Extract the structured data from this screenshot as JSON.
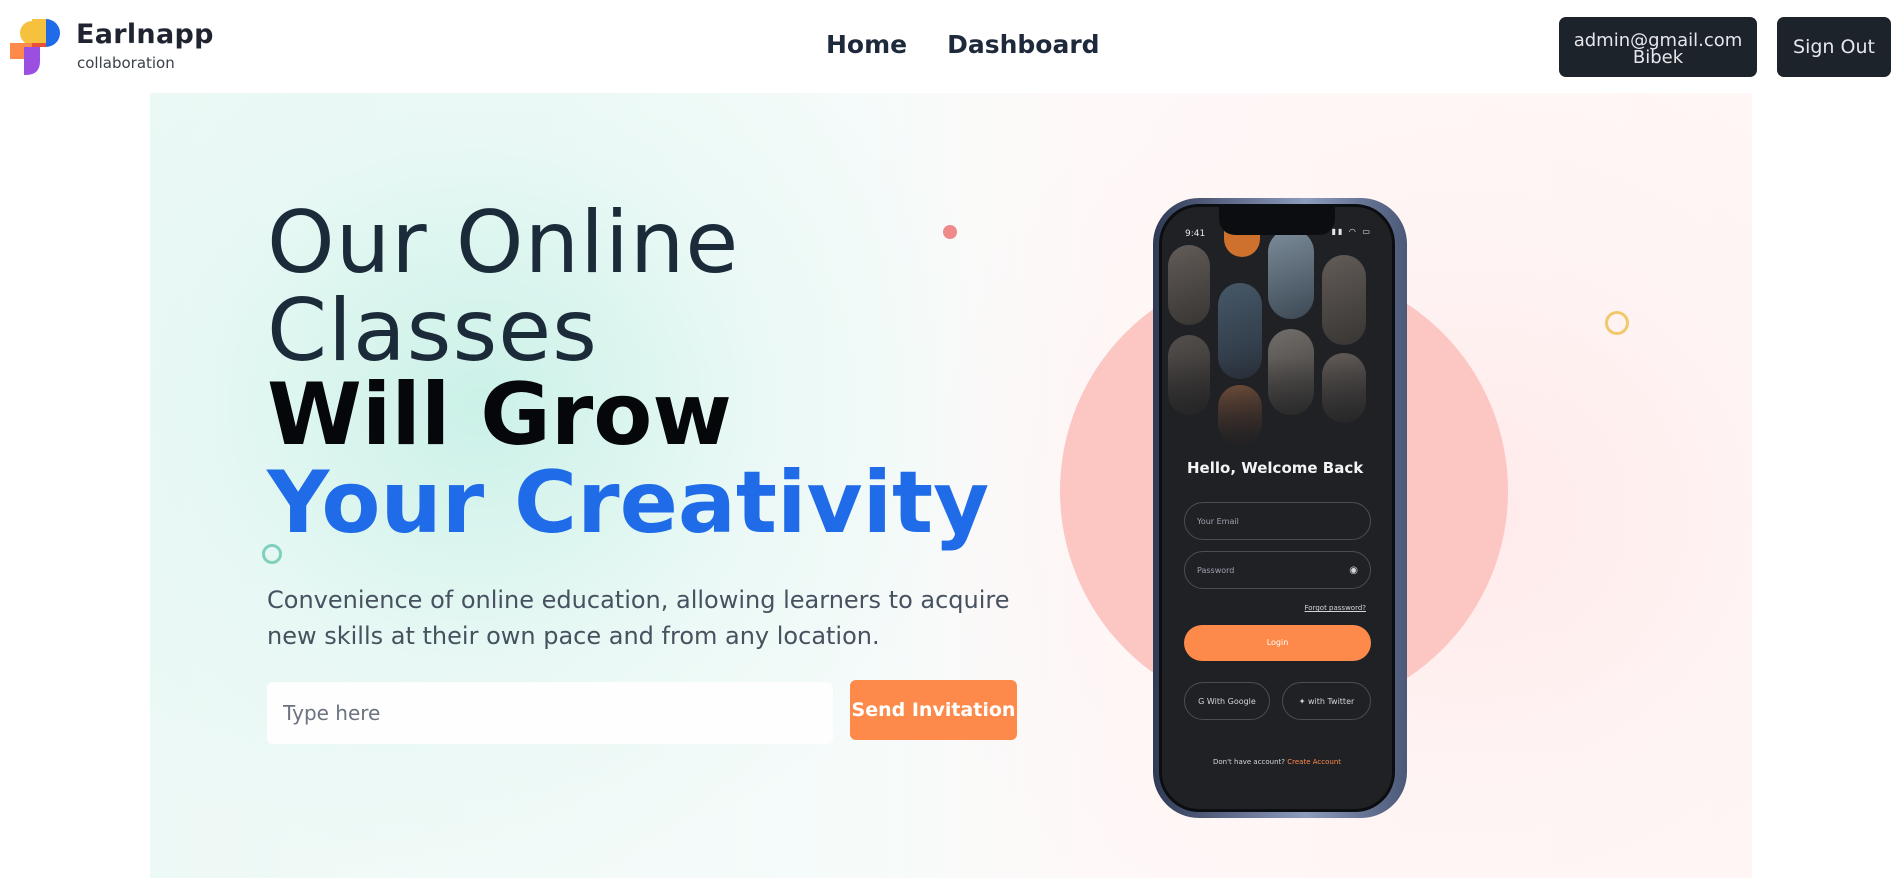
{
  "header": {
    "logo_name": "Earlnapp",
    "logo_sub": "collaboration",
    "nav": [
      {
        "label": "Home"
      },
      {
        "label": "Dashboard"
      }
    ],
    "user_email": "admin@gmail.com",
    "user_name": "Bibek",
    "signout_label": "Sign Out"
  },
  "hero": {
    "line1": "Our Online",
    "line2": "Classes",
    "line3": "Will Grow",
    "line4": "Your Creativity",
    "description": "Convenience of online education, allowing learners to acquire new skills at their own pace and from any location.",
    "input_placeholder": "Type here",
    "send_label": "Send Invitation"
  },
  "phone": {
    "time": "9:41",
    "welcome": "Hello, Welcome Back",
    "email_placeholder": "Your Email",
    "password_placeholder": "Password",
    "forgot": "Forgot password?",
    "login": "Login",
    "google": "With Google",
    "twitter": "with Twitter",
    "no_account": "Don't have account?",
    "create_account": "Create Account"
  },
  "colors": {
    "accent": "#fd8a4a",
    "blue": "#1f6be8",
    "dark_button": "#1d232a"
  }
}
